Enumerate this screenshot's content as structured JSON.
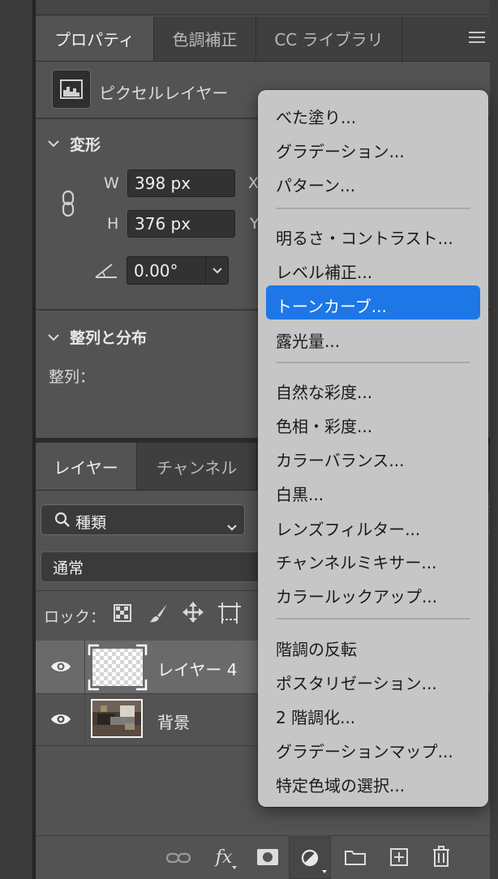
{
  "properties_panel": {
    "tabs": [
      {
        "label": "プロパティ",
        "active": true
      },
      {
        "label": "色調補正",
        "active": false
      },
      {
        "label": "CC ライブラリ",
        "active": false
      }
    ],
    "layer_type_label": "ピクセルレイヤー",
    "transform": {
      "heading": "変形",
      "w_label": "W",
      "w_value": "398 px",
      "h_label": "H",
      "h_value": "376 px",
      "x_label": "X",
      "y_label": "Y",
      "angle_value": "0.00°"
    },
    "align": {
      "heading": "整列と分布",
      "label": "整列："
    }
  },
  "layers_panel": {
    "tabs": [
      {
        "label": "レイヤー",
        "active": true
      },
      {
        "label": "チャンネル",
        "active": false
      }
    ],
    "filter_label": "種類",
    "blend_mode": "通常",
    "lock_label": "ロック：",
    "layers": [
      {
        "name": "レイヤー 4",
        "selected": true
      },
      {
        "name": "背景",
        "selected": false
      }
    ],
    "bottom_toolbar": [
      "link-icon",
      "fx-icon",
      "mask-icon",
      "adjustment-icon",
      "folder-icon",
      "new-layer-icon",
      "trash-icon"
    ],
    "fx_label": "fx"
  },
  "adjustment_menu": {
    "groups": [
      [
        "べた塗り...",
        "グラデーション...",
        "パターン..."
      ],
      [
        "明るさ・コントラスト...",
        "レベル補正...",
        "トーンカーブ...",
        "露光量..."
      ],
      [
        "自然な彩度...",
        "色相・彩度...",
        "カラーバランス...",
        "白黒...",
        "レンズフィルター...",
        "チャンネルミキサー...",
        "カラールックアップ..."
      ],
      [
        "階調の反転",
        "ポスタリゼーション...",
        "2 階調化...",
        "グラデーションマップ...",
        "特定色域の選択..."
      ]
    ],
    "highlighted_item": "トーンカーブ...",
    "highlight_color": "#1d77e6"
  }
}
